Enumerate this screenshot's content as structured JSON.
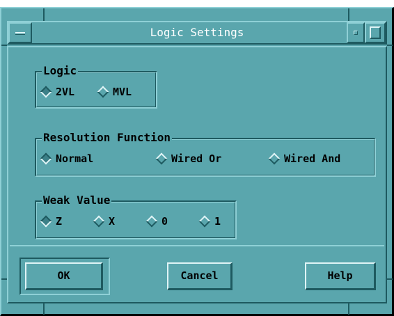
{
  "window": {
    "title": "Logic Settings"
  },
  "groups": {
    "logic": {
      "label": "Logic",
      "options": [
        "2VL",
        "MVL"
      ],
      "selected": "2VL"
    },
    "resolution": {
      "label": "Resolution Function",
      "options": [
        "Normal",
        "Wired Or",
        "Wired And"
      ],
      "selected": "Normal"
    },
    "weak": {
      "label": "Weak Value",
      "options": [
        "Z",
        "X",
        "0",
        "1"
      ],
      "selected": "Z"
    }
  },
  "buttons": {
    "ok": "OK",
    "cancel": "Cancel",
    "help": "Help"
  },
  "colors": {
    "background": "#5aa6ad",
    "highlight": "#8fd0d6",
    "shadow": "#1e5a60",
    "title_text": "#ffffff"
  },
  "icons": {
    "window_menu": "window-menu-icon",
    "minimize": "minimize-icon",
    "maximize": "maximize-icon",
    "radio": "diamond-radio-icon"
  }
}
